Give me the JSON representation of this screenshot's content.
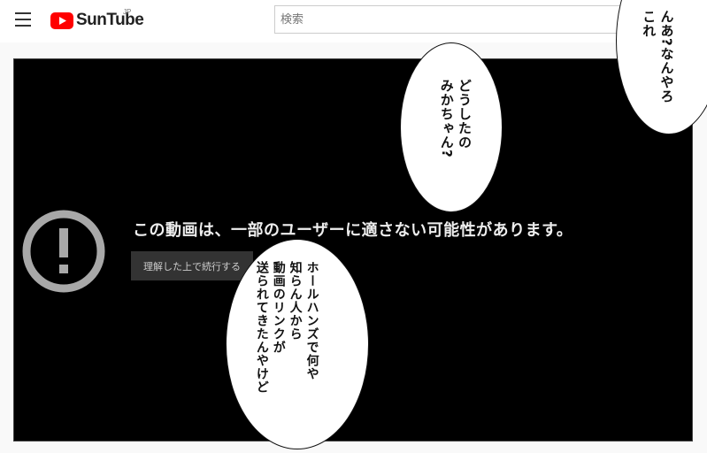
{
  "header": {
    "logo_text": "SunTube",
    "logo_region": "JP",
    "search_placeholder": "検索"
  },
  "player": {
    "warning_message": "この動画は、一部のユーザーに適さない可能性があります。",
    "continue_label": "理解した上で続行する"
  },
  "bubbles": {
    "top_right": "んあ?なんやろ\nこれ",
    "middle": "どうしたの\nみかちゃん?",
    "bottom": "ホールハンズで何や\n知らん人から\n動画のリンクが\n送られてきたんやけど"
  },
  "colors": {
    "logo_red": "#ff0000",
    "player_bg": "#000000",
    "button_bg": "#333333",
    "warning_icon": "#a8a8a8"
  }
}
